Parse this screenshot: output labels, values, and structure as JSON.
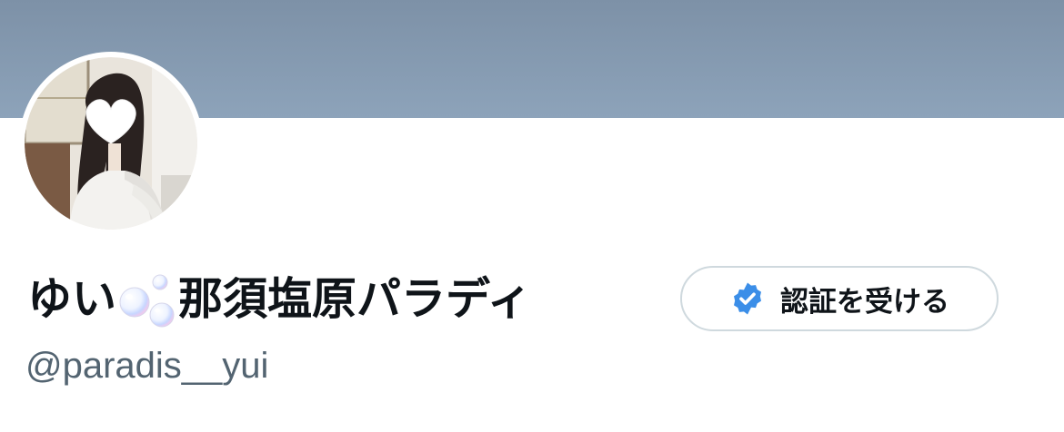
{
  "profile": {
    "display_name_part1": "ゆい",
    "display_name_part2": "那須塩原パラディ",
    "handle": "@paradis__yui",
    "verify_button_label": "認証を受ける"
  },
  "icons": {
    "avatar": "profile-photo",
    "bubbles": "bubbles-emoji",
    "verify_badge": "verified-badge-icon"
  },
  "colors": {
    "banner": "#8a9fb5",
    "text_primary": "#0f1419",
    "text_secondary": "#536471",
    "badge_blue": "#3b8ee8",
    "button_border": "#cfd9de"
  }
}
